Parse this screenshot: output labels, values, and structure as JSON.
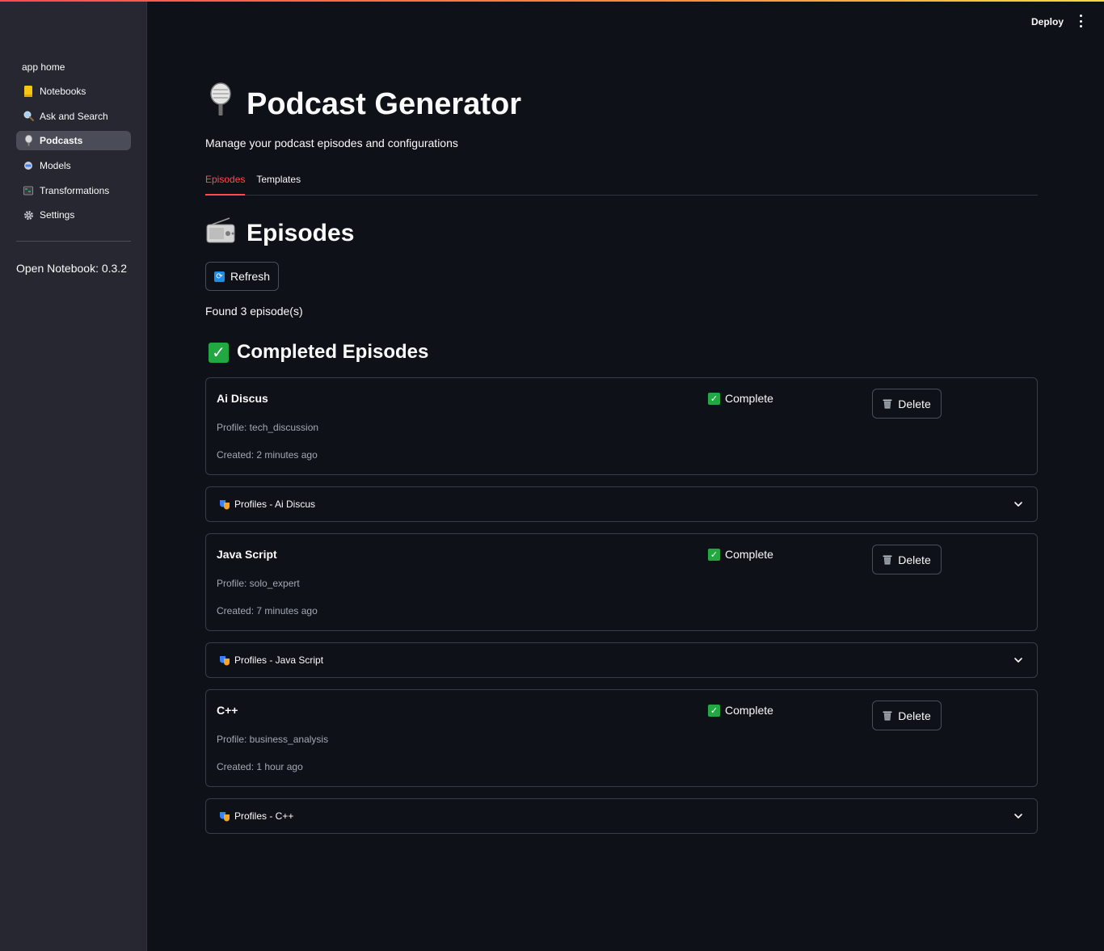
{
  "sidebar": {
    "section_label": "app home",
    "items": [
      {
        "label": "Notebooks",
        "icon": "notebook-icon",
        "active": false
      },
      {
        "label": "Ask and Search",
        "icon": "magnifier-icon",
        "active": false
      },
      {
        "label": "Podcasts",
        "icon": "microphone-icon",
        "active": true
      },
      {
        "label": "Models",
        "icon": "robot-icon",
        "active": false
      },
      {
        "label": "Transformations",
        "icon": "transformations-icon",
        "active": false
      },
      {
        "label": "Settings",
        "icon": "gear-icon",
        "active": false
      }
    ],
    "version": "Open Notebook: 0.3.2"
  },
  "header": {
    "deploy_label": "Deploy",
    "menu_icon": "kebab-menu-icon"
  },
  "main": {
    "title": "Podcast Generator",
    "title_icon": "microphone-icon",
    "subtitle": "Manage your podcast episodes and configurations",
    "tabs": [
      {
        "label": "Episodes",
        "active": true
      },
      {
        "label": "Templates",
        "active": false
      }
    ],
    "section_title": "Episodes",
    "section_icon": "radio-icon",
    "refresh_label": "Refresh",
    "found_text": "Found 3 episode(s)",
    "completed_title": "Completed Episodes",
    "episodes": [
      {
        "name": "Ai Discus",
        "profile": "Profile: tech_discussion",
        "created": "Created: 2 minutes ago",
        "status": "Complete",
        "delete_label": "Delete",
        "expander_label": "Profiles - Ai Discus"
      },
      {
        "name": "Java Script",
        "profile": "Profile: solo_expert",
        "created": "Created: 7 minutes ago",
        "status": "Complete",
        "delete_label": "Delete",
        "expander_label": "Profiles - Java Script"
      },
      {
        "name": "C++",
        "profile": "Profile: business_analysis",
        "created": "Created: 1 hour ago",
        "status": "Complete",
        "delete_label": "Delete",
        "expander_label": "Profiles - C++"
      }
    ]
  },
  "colors": {
    "background": "#0e1117",
    "sidebar": "#262730",
    "accent": "#ff4b4b",
    "success": "#21a842"
  }
}
